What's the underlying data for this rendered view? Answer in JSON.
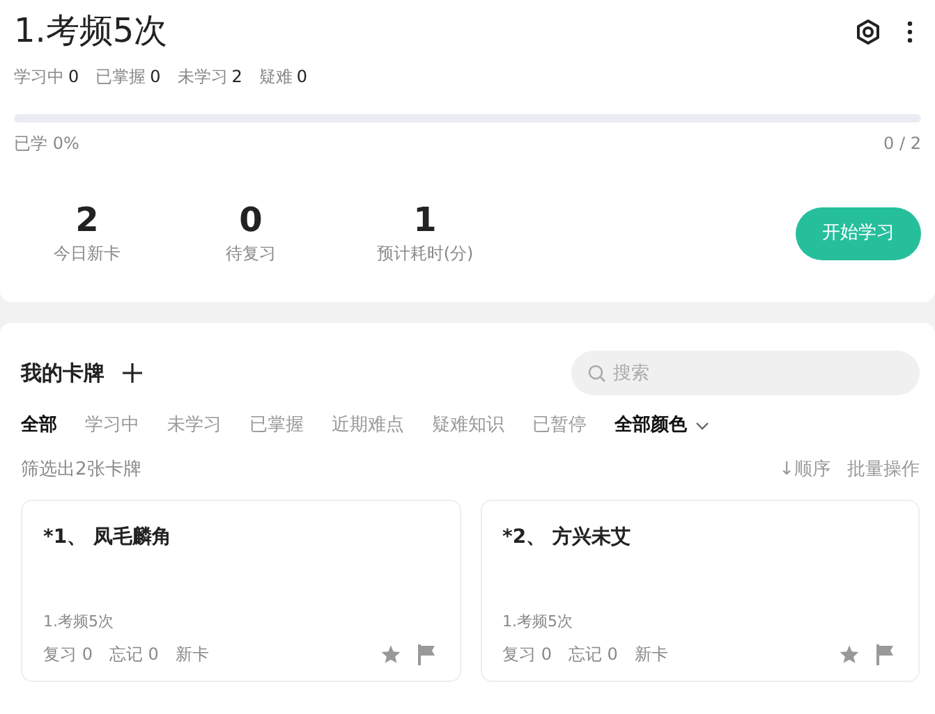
{
  "deck": {
    "title": "1.考频5次"
  },
  "counts": [
    {
      "label": "学习中",
      "value": "0"
    },
    {
      "label": "已掌握",
      "value": "0"
    },
    {
      "label": "未学习",
      "value": "2"
    },
    {
      "label": "疑难",
      "value": "0"
    }
  ],
  "progress": {
    "level": 0,
    "label": "已学 0%",
    "ratio": "0 / 2"
  },
  "summary": [
    {
      "value": "2",
      "label": "今日新卡"
    },
    {
      "value": "0",
      "label": "待复习"
    },
    {
      "value": "1",
      "label": "预计耗时(分)"
    }
  ],
  "start_button": "开始学习",
  "cards_section": {
    "title": "我的卡牌",
    "search": {
      "placeholder": "搜索"
    }
  },
  "filters": [
    {
      "label": "全部",
      "selected": true
    },
    {
      "label": "学习中",
      "selected": false
    },
    {
      "label": "未学习",
      "selected": false
    },
    {
      "label": "已掌握",
      "selected": false
    },
    {
      "label": "近期难点",
      "selected": false
    },
    {
      "label": "疑难知识",
      "selected": false
    },
    {
      "label": "已暂停",
      "selected": false
    }
  ],
  "color_filter": "全部颜色",
  "result_count": "筛选出2张卡牌",
  "sort": "↓顺序",
  "batch": "批量操作",
  "cards": [
    {
      "title": "*1、 凤毛麟角",
      "deck": "1.考频5次",
      "review": "复习 0",
      "forget": "忘记 0",
      "status": "新卡"
    },
    {
      "title": "*2、 方兴未艾",
      "deck": "1.考频5次",
      "review": "复习 0",
      "forget": "忘记 0",
      "status": "新卡"
    }
  ]
}
